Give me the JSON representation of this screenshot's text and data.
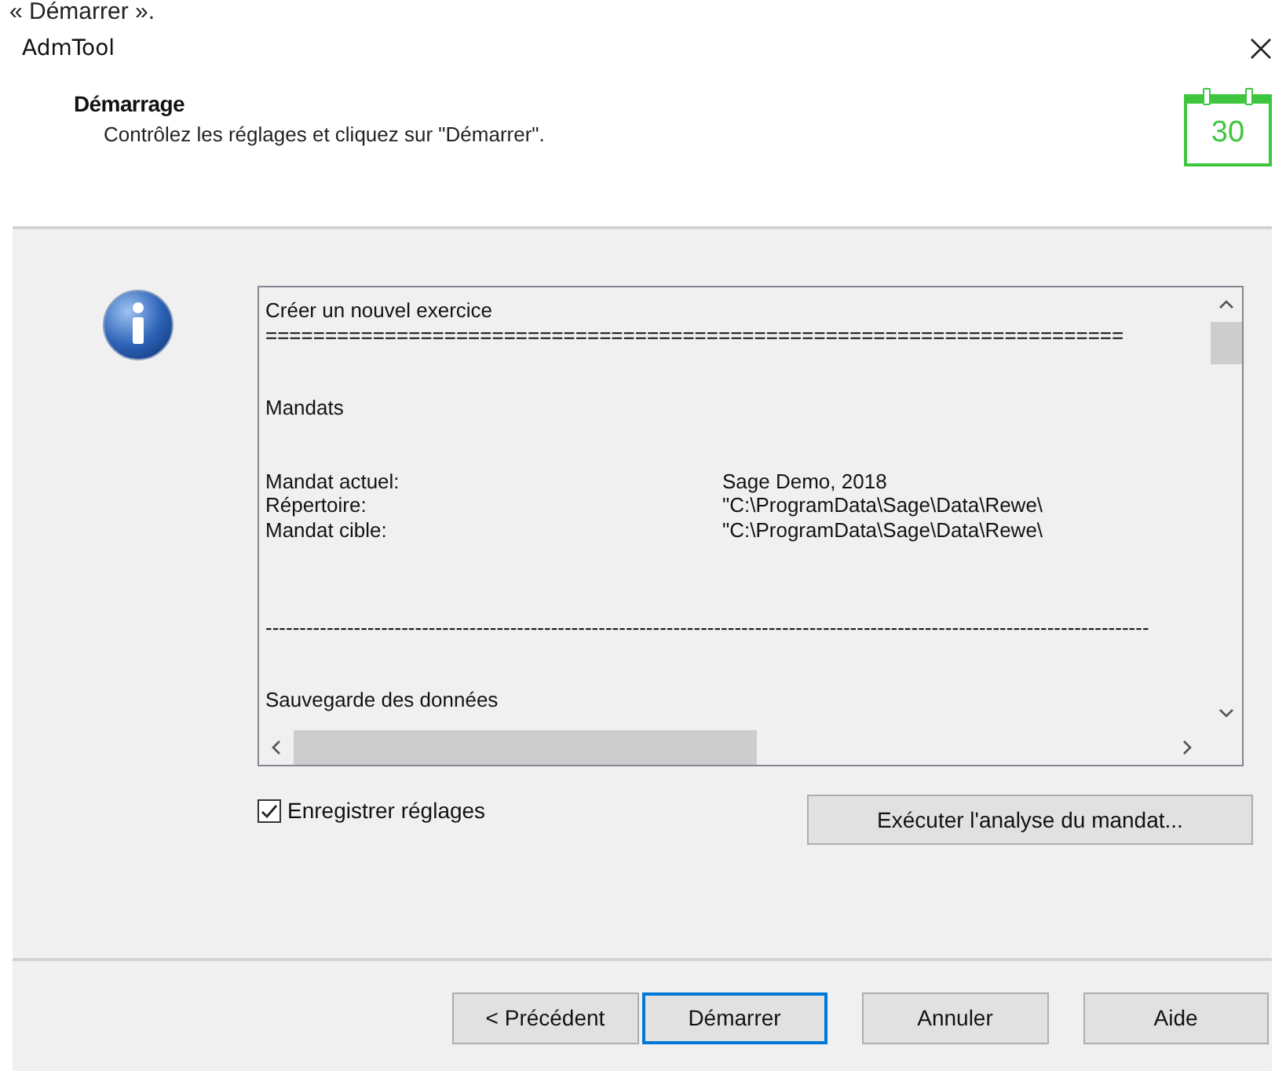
{
  "caption_fragment": "« Démarrer ».",
  "window": {
    "title": "AdmTool"
  },
  "header": {
    "title": "Démarrage",
    "subtitle": "Contrôlez les réglages et cliquez sur \"Démarrer\".",
    "calendar_day": "30"
  },
  "log": {
    "lines": [
      {
        "kind": "text",
        "text": "Créer un nouvel exercice"
      },
      {
        "kind": "rule",
        "text": "========================================================================"
      },
      {
        "kind": "blank"
      },
      {
        "kind": "blank"
      },
      {
        "kind": "text",
        "text": "Mandats"
      },
      {
        "kind": "blank"
      },
      {
        "kind": "blank"
      },
      {
        "kind": "pair",
        "label": "Mandat actuel:",
        "value": "Sage Demo, 2018"
      },
      {
        "kind": "pair",
        "label": "Répertoire:",
        "value": "\"C:\\ProgramData\\Sage\\Data\\Rewe\\"
      },
      {
        "kind": "pair",
        "label": "Mandat cible:",
        "value": "\"C:\\ProgramData\\Sage\\Data\\Rewe\\"
      },
      {
        "kind": "blank"
      },
      {
        "kind": "blank"
      },
      {
        "kind": "blank"
      },
      {
        "kind": "rule",
        "text": "----------------------------------------------------------------------------------------------------------------------------------"
      },
      {
        "kind": "blank"
      },
      {
        "kind": "blank"
      },
      {
        "kind": "text",
        "text": "Sauvegarde des données"
      }
    ]
  },
  "save_settings": {
    "label": "Enregistrer réglages",
    "checked": true
  },
  "analysis_button": "Exécuter l'analyse du mandat...",
  "buttons": [
    {
      "label": "< Précédent",
      "default": false
    },
    {
      "label": "Démarrer",
      "default": true
    },
    {
      "label": "Annuler",
      "default": false
    },
    {
      "label": "Aide",
      "default": false
    }
  ]
}
